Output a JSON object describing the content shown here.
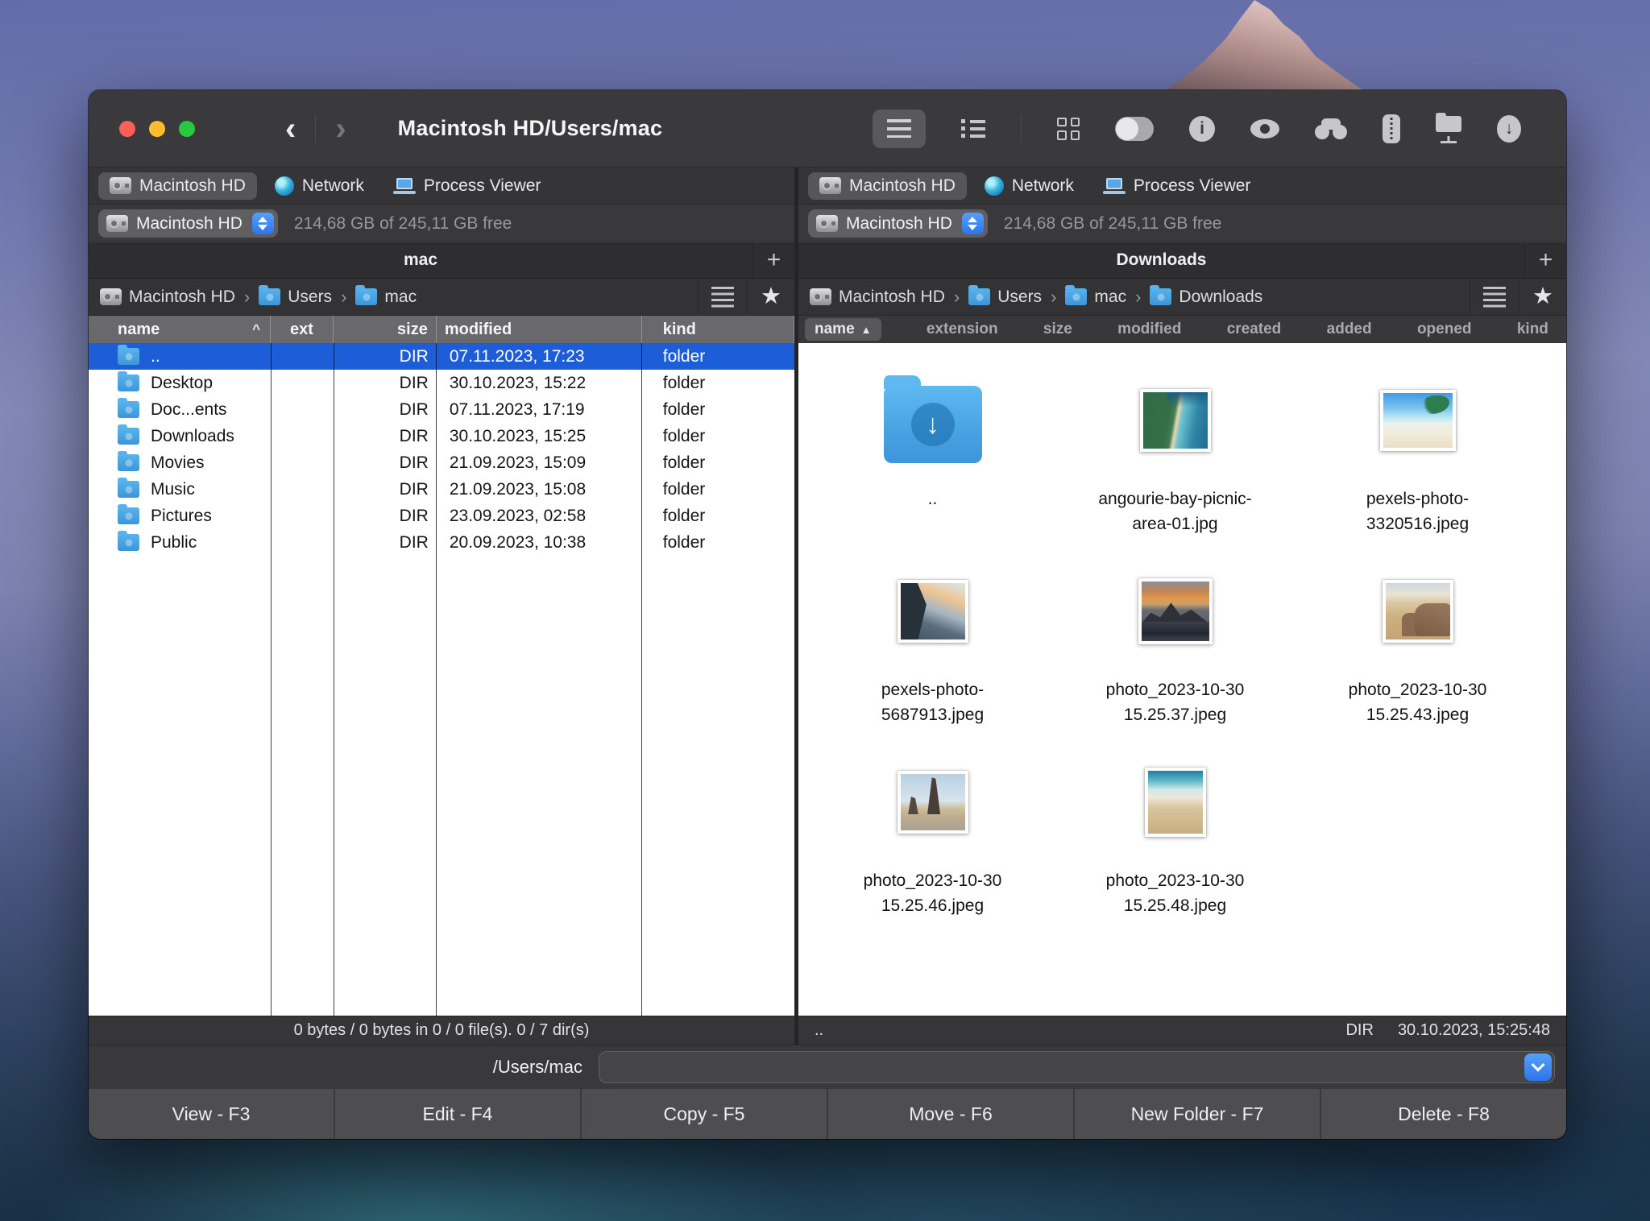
{
  "titlebar": {
    "title": "Macintosh HD/Users/mac"
  },
  "toolbar": {
    "icons": [
      "list-view",
      "detail-view",
      "grid-view",
      "toggle-panel",
      "info",
      "preview-eye",
      "search-binoculars",
      "archive-zip",
      "network-folder",
      "downloads"
    ]
  },
  "tabs": [
    "Macintosh HD",
    "Network",
    "Process Viewer"
  ],
  "drive": {
    "name": "Macintosh HD",
    "free": "214,68 GB of 245,11 GB free"
  },
  "left_pane": {
    "tab_title": "mac",
    "add_tab": "+",
    "breadcrumb": [
      "Macintosh HD",
      "Users",
      "mac"
    ],
    "columns": {
      "name": "name",
      "sort": "^",
      "ext": "ext",
      "size": "size",
      "modified": "modified",
      "kind": "kind"
    },
    "rows": [
      {
        "name": "..",
        "ext": "",
        "size": "DIR",
        "modified": "07.11.2023, 17:23",
        "kind": "folder"
      },
      {
        "name": "Desktop",
        "ext": "",
        "size": "DIR",
        "modified": "30.10.2023, 15:22",
        "kind": "folder"
      },
      {
        "name": "Doc...ents",
        "ext": "",
        "size": "DIR",
        "modified": "07.11.2023, 17:19",
        "kind": "folder"
      },
      {
        "name": "Downloads",
        "ext": "",
        "size": "DIR",
        "modified": "30.10.2023, 15:25",
        "kind": "folder"
      },
      {
        "name": "Movies",
        "ext": "",
        "size": "DIR",
        "modified": "21.09.2023, 15:09",
        "kind": "folder"
      },
      {
        "name": "Music",
        "ext": "",
        "size": "DIR",
        "modified": "21.09.2023, 15:08",
        "kind": "folder"
      },
      {
        "name": "Pictures",
        "ext": "",
        "size": "DIR",
        "modified": "23.09.2023, 02:58",
        "kind": "folder"
      },
      {
        "name": "Public",
        "ext": "",
        "size": "DIR",
        "modified": "20.09.2023, 10:38",
        "kind": "folder"
      }
    ],
    "status": "0 bytes / 0 bytes in 0 / 0 file(s). 0 / 7 dir(s)"
  },
  "right_pane": {
    "tab_title": "Downloads",
    "add_tab": "+",
    "breadcrumb": [
      "Macintosh HD",
      "Users",
      "mac",
      "Downloads"
    ],
    "columns": [
      "name",
      "extension",
      "size",
      "modified",
      "created",
      "added",
      "opened",
      "kind"
    ],
    "sort_arrow": "▲",
    "items": [
      {
        "name": ".."
      },
      {
        "name": "angourie-bay-picnic-area-01.jpg"
      },
      {
        "name": "pexels-photo-3320516.jpeg"
      },
      {
        "name": "pexels-photo-5687913.jpeg"
      },
      {
        "name": "photo_2023-10-30 15.25.37.jpeg"
      },
      {
        "name": "photo_2023-10-30 15.25.43.jpeg"
      },
      {
        "name": "photo_2023-10-30 15.25.46.jpeg"
      },
      {
        "name": "photo_2023-10-30 15.25.48.jpeg"
      }
    ],
    "status_item": "..",
    "status_kind": "DIR",
    "status_date": "30.10.2023, 15:25:48"
  },
  "command": {
    "label": "/Users/mac",
    "value": ""
  },
  "function_keys": [
    "View - F3",
    "Edit - F4",
    "Copy - F5",
    "Move - F6",
    "New Folder - F7",
    "Delete - F8"
  ],
  "colors": {
    "accent": "#3b7ef7",
    "selection": "#1d5ed8",
    "folder_blue": "#4aa3e8",
    "pane_bg": "#ffffff",
    "chrome": "#39393b"
  }
}
